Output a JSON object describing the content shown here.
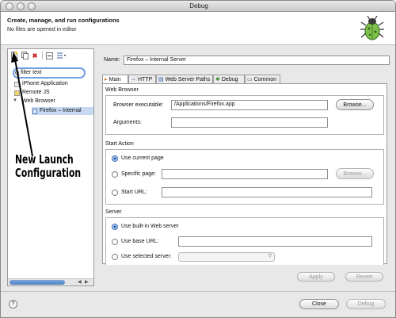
{
  "window": {
    "title": "Debug"
  },
  "header": {
    "title": "Create, manage, and run configurations",
    "subtitle": "No files are opened in editor",
    "logo_icon": "bug-icon"
  },
  "left": {
    "toolbar": [
      {
        "name": "new-launch-config-icon",
        "glyph": "📄"
      },
      {
        "name": "duplicate-icon",
        "glyph": "⧉"
      },
      {
        "name": "delete-icon",
        "glyph": "✖"
      },
      {
        "name": "collapse-all-icon",
        "glyph": "⊟"
      },
      {
        "name": "filter-icon",
        "glyph": "⇶"
      }
    ],
    "filter_placeholder": "filter text",
    "tree": [
      {
        "label": "iPhone Application"
      },
      {
        "label": "Remote JS"
      },
      {
        "label": "Web Browser",
        "expanded": true
      },
      {
        "label": "Firefox – Internal",
        "selected": true
      }
    ]
  },
  "annotation": {
    "line1": "New Launch",
    "line2": "Configuration"
  },
  "config": {
    "name_label": "Name:",
    "name_value": "Firefox – Internal Server",
    "tabs": [
      {
        "label": "Main",
        "icon": "main-tab-icon",
        "active": true
      },
      {
        "label": "HTTP",
        "icon": "http-tab-icon"
      },
      {
        "label": "Web Server Paths",
        "icon": "server-paths-tab-icon"
      },
      {
        "label": "Debug",
        "icon": "debug-tab-icon"
      },
      {
        "label": "Common",
        "icon": "common-tab-icon"
      }
    ],
    "web_browser": {
      "group_title": "Web Browser",
      "executable_label": "Browser executable:",
      "executable_value": "/Applications/Firefox.app",
      "browse_label": "Browse...",
      "arguments_label": "Arguments:",
      "arguments_value": ""
    },
    "start_action": {
      "group_title": "Start Action",
      "use_current_page": "Use current page",
      "specific_page": "Specific page:",
      "specific_browse": "Browse...",
      "start_url": "Start URL:"
    },
    "server": {
      "group_title": "Server",
      "builtin": "Use built-in Web server",
      "base_url": "Use base URL:",
      "selected_server": "Use selected server:"
    }
  },
  "buttons": {
    "apply": "Apply",
    "revert": "Revert",
    "close": "Close",
    "debug": "Debug",
    "help": "?"
  }
}
